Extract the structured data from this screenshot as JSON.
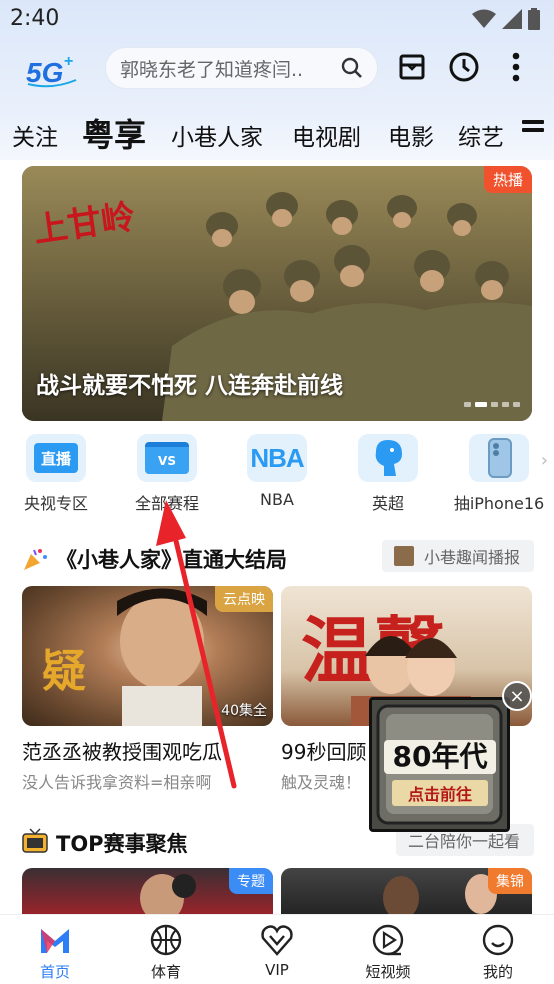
{
  "status": {
    "time": "2:40"
  },
  "header": {
    "logo_text": "5G",
    "search_placeholder": "郭晓东老了知道疼闫..",
    "icons": [
      "logo-5g-icon",
      "search-icon",
      "mail-icon",
      "clock-icon",
      "more-vert-icon"
    ]
  },
  "nav": {
    "tabs": [
      {
        "label": "关注"
      },
      {
        "label": "粤享"
      },
      {
        "label": "小巷人家"
      },
      {
        "label": "电视剧"
      },
      {
        "label": "电影"
      },
      {
        "label": "综艺"
      }
    ]
  },
  "banner": {
    "badge": "热播",
    "title": "战斗就要不怕死 八连奔赴前线",
    "poster_text": "上甘岭"
  },
  "quick_links": [
    {
      "label": "央视专区",
      "icon_text": "直播",
      "icon": "live-tv-icon"
    },
    {
      "label": "全部赛程",
      "icon_text": "VS",
      "icon": "calendar-vs-icon"
    },
    {
      "label": "NBA",
      "icon_text": "NBA",
      "icon": "nba-icon"
    },
    {
      "label": "英超",
      "icon_text": "",
      "icon": "premier-league-lion-icon"
    },
    {
      "label": "抽iPhone16",
      "icon_text": "",
      "icon": "iphone-icon"
    }
  ],
  "section1": {
    "title": "《小巷人家》直通大结局",
    "link": "小巷趣闻播报",
    "cards": [
      {
        "badge": "云点映",
        "count": "40集全",
        "title": "范丞丞被教授围观吃瓜",
        "subtitle": "没人告诉我拿资料=相亲啊",
        "poster_text": "疑"
      },
      {
        "badge": "",
        "count": "",
        "title": "99秒回顾",
        "subtitle": "触及灵魂！",
        "poster_text": "温馨"
      }
    ]
  },
  "popup": {
    "title": "80年代",
    "cta": "点击前往",
    "close": "×"
  },
  "section2": {
    "title": "TOP赛事聚焦",
    "link": "二台陪你一起看",
    "cards": [
      {
        "badge": "专题"
      },
      {
        "badge": "集锦"
      }
    ]
  },
  "bottom_nav": [
    {
      "label": "首页",
      "icon": "home-m-icon",
      "active": true
    },
    {
      "label": "体育",
      "icon": "basketball-icon",
      "active": false
    },
    {
      "label": "VIP",
      "icon": "vip-heart-icon",
      "active": false
    },
    {
      "label": "短视频",
      "icon": "play-circle-icon",
      "active": false
    },
    {
      "label": "我的",
      "icon": "smile-face-icon",
      "active": false
    }
  ],
  "colors": {
    "accent": "#2d7df6",
    "hot_badge": "#f0522d",
    "card_badge_gold": "#d9a441",
    "card_badge_blue": "#3b8cf5",
    "card_badge_orange": "#f07a2d",
    "arrow_red": "#e8242a"
  }
}
